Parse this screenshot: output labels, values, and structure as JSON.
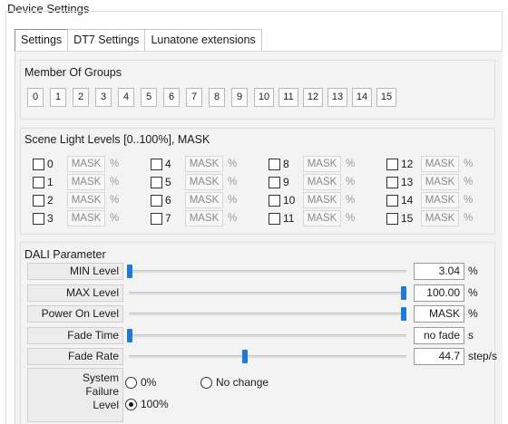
{
  "window": {
    "title": "Device Settings"
  },
  "tabs": [
    {
      "label": "Settings",
      "active": true
    },
    {
      "label": "DT7 Settings",
      "active": false
    },
    {
      "label": "Lunatone extensions",
      "active": false
    }
  ],
  "groups": {
    "title": "Member Of Groups",
    "buttons": [
      "0",
      "1",
      "2",
      "3",
      "4",
      "5",
      "6",
      "7",
      "8",
      "9",
      "10",
      "11",
      "12",
      "13",
      "14",
      "15"
    ]
  },
  "scenes": {
    "title": "Scene Light Levels [0..100%], MASK",
    "mask_label": "MASK",
    "unit": "%",
    "items": [
      "0",
      "1",
      "2",
      "3",
      "4",
      "5",
      "6",
      "7",
      "8",
      "9",
      "10",
      "11",
      "12",
      "13",
      "14",
      "15"
    ]
  },
  "dali": {
    "title": "DALI Parameter",
    "params": [
      {
        "label": "MIN Level",
        "value": "3.04",
        "unit": "%",
        "slider_fraction": 0.0
      },
      {
        "label": "MAX Level",
        "value": "100.00",
        "unit": "%",
        "slider_fraction": 1.0
      },
      {
        "label": "Power On Level",
        "value": "MASK",
        "unit": "%",
        "slider_fraction": 1.0
      },
      {
        "label": "Fade Time",
        "value": "no fade",
        "unit": "s",
        "slider_fraction": 0.0
      },
      {
        "label": "Fade Rate",
        "value": "44.7",
        "unit": "step/s",
        "slider_fraction": 0.42
      }
    ],
    "system_failure": {
      "label_lines": [
        "System",
        "Failure",
        "Level"
      ],
      "options": [
        {
          "label": "0%",
          "selected": false
        },
        {
          "label": "No change",
          "selected": false
        },
        {
          "label": "100%",
          "selected": true
        }
      ]
    }
  },
  "colors": {
    "slider_thumb": "#1f7ad6",
    "panel_bg": "#f3f3f3"
  },
  "icons": {
    "checkbox": "checkbox-icon",
    "radio": "radio-icon"
  }
}
